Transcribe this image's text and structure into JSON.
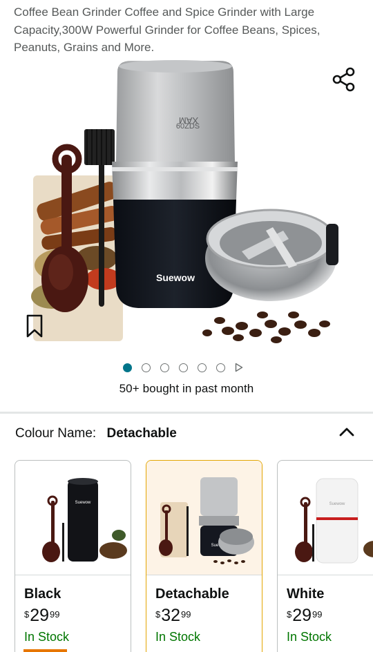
{
  "product": {
    "title": "Coffee Bean Grinder Coffee and Spice Grinder with Large Capacity,300W Powerful Grinder for Coffee Beans, Spices, Peanuts, Grains and More.",
    "brand_on_image": "Suewow",
    "engraving_on_image": "MAX 60ZDS"
  },
  "carousel": {
    "dots": 6,
    "active_index": 0,
    "play_icon": "play-triangle-icon"
  },
  "social_proof": "50+ bought in past month",
  "icons": {
    "share": "share-icon",
    "bookmark": "bookmark-icon",
    "collapse": "chevron-up-icon"
  },
  "colour": {
    "label": "Colour Name:",
    "selected": "Detachable",
    "options": [
      {
        "name": "Black",
        "currency": "$",
        "whole": "29",
        "fraction": "99",
        "stock": "In Stock",
        "selected": false
      },
      {
        "name": "Detachable",
        "currency": "$",
        "whole": "32",
        "fraction": "99",
        "stock": "In Stock",
        "selected": true
      },
      {
        "name": "White",
        "currency": "$",
        "whole": "29",
        "fraction": "99",
        "stock": "In Stock",
        "selected": false
      }
    ]
  },
  "colors": {
    "accent_teal": "#00758a",
    "stock_green": "#007600",
    "selected_border": "#e3a500",
    "selected_bg": "#fdf3e6",
    "tab_orange": "#e77600"
  }
}
